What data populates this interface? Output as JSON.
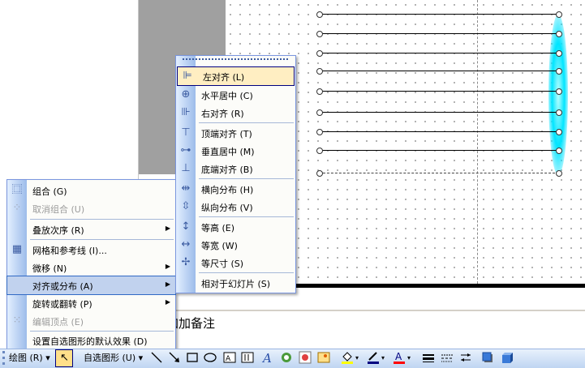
{
  "notes": {
    "text": "加加备注"
  },
  "context_menu": {
    "items": [
      {
        "label": "组合 (G)",
        "icon": "group-icon",
        "disabled": false,
        "submenu": false
      },
      {
        "label": "取消组合 (U)",
        "icon": "ungroup-icon",
        "disabled": true,
        "submenu": false
      },
      {
        "label": "叠放次序 (R)",
        "icon": "",
        "disabled": false,
        "submenu": true
      },
      {
        "label": "网格和参考线 (I)...",
        "icon": "grid-icon",
        "disabled": false,
        "submenu": false
      },
      {
        "label": "微移 (N)",
        "icon": "",
        "disabled": false,
        "submenu": true
      },
      {
        "label": "对齐或分布 (A)",
        "icon": "",
        "disabled": false,
        "submenu": true
      },
      {
        "label": "旋转或翻转 (P)",
        "icon": "",
        "disabled": false,
        "submenu": true
      },
      {
        "label": "编辑顶点 (E)",
        "icon": "edit-points-icon",
        "disabled": true,
        "submenu": false
      },
      {
        "label": "设置自选图形的默认效果 (D)",
        "icon": "",
        "disabled": false,
        "submenu": false
      }
    ]
  },
  "align_submenu": {
    "items": [
      {
        "label": "左对齐 (L)",
        "icon": "align-left-icon"
      },
      {
        "label": "水平居中 (C)",
        "icon": "align-center-icon"
      },
      {
        "label": "右对齐 (R)",
        "icon": "align-right-icon"
      },
      {
        "label": "顶端对齐 (T)",
        "icon": "align-top-icon"
      },
      {
        "label": "垂直居中 (M)",
        "icon": "align-middle-icon"
      },
      {
        "label": "底端对齐 (B)",
        "icon": "align-bottom-icon"
      },
      {
        "label": "横向分布 (H)",
        "icon": "distribute-horizontal-icon"
      },
      {
        "label": "纵向分布 (V)",
        "icon": "distribute-vertical-icon"
      },
      {
        "label": "等高 (E)",
        "icon": "same-height-icon"
      },
      {
        "label": "等宽 (W)",
        "icon": "same-width-icon"
      },
      {
        "label": "等尺寸 (S)",
        "icon": "same-size-icon"
      },
      {
        "label": "相对于幻灯片 (S)",
        "icon": ""
      }
    ]
  },
  "toolbar": {
    "draw_label": "绘图 (R) ▾",
    "autoshape_label": "自选图形 (U) ▾",
    "colors": {
      "fill": "#ffff00",
      "line": "#000080",
      "font": "#ff0000"
    }
  }
}
